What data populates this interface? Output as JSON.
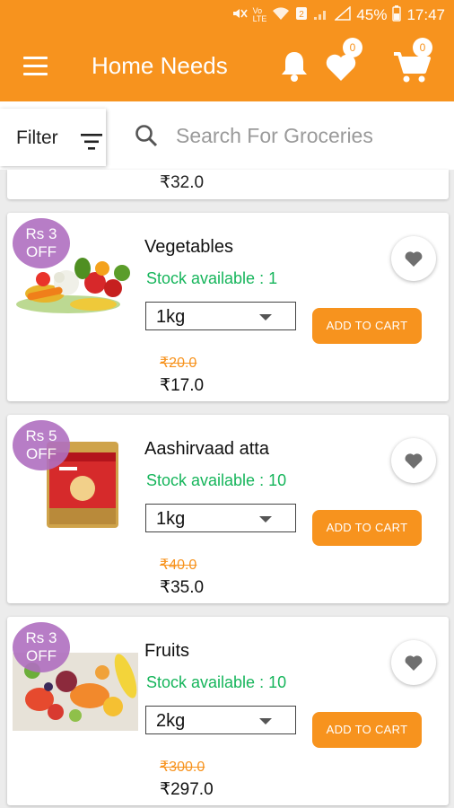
{
  "status_bar": {
    "battery": "45%",
    "time": "17:47",
    "icons": [
      "mute-icon",
      "volte-icon",
      "wifi-icon",
      "sim2-icon",
      "signal-icon",
      "battery-icon"
    ]
  },
  "app_bar": {
    "title": "Home Needs",
    "wishlist_count": "0",
    "cart_count": "0",
    "icons": [
      "menu-icon",
      "bell-icon",
      "heart-icon",
      "cart-icon"
    ]
  },
  "filter": {
    "label": "Filter",
    "icon": "filter-icon"
  },
  "search": {
    "placeholder": "Search For Groceries",
    "value": ""
  },
  "partial_product": {
    "price": "₹32.0"
  },
  "products": [
    {
      "name": "Vegetables",
      "discount_line1": "Rs  3",
      "discount_line2": "OFF",
      "stock": "Stock available : 1",
      "quantity": "1kg",
      "old_price": "₹20.0",
      "price": "₹17.0",
      "add_label": "ADD TO CART"
    },
    {
      "name": "Aashirvaad atta",
      "discount_line1": "Rs  5",
      "discount_line2": "OFF",
      "stock": "Stock available : 10",
      "quantity": "1kg",
      "old_price": "₹40.0",
      "price": "₹35.0",
      "add_label": "ADD TO CART"
    },
    {
      "name": "Fruits",
      "discount_line1": "Rs  3",
      "discount_line2": "OFF",
      "stock": "Stock available : 10",
      "quantity": "2kg",
      "old_price": "₹300.0",
      "price": "₹297.0",
      "add_label": "ADD TO CART"
    }
  ],
  "colors": {
    "accent": "#f7931e",
    "stock": "#16b55b",
    "discount_badge": "#b06fc0"
  }
}
